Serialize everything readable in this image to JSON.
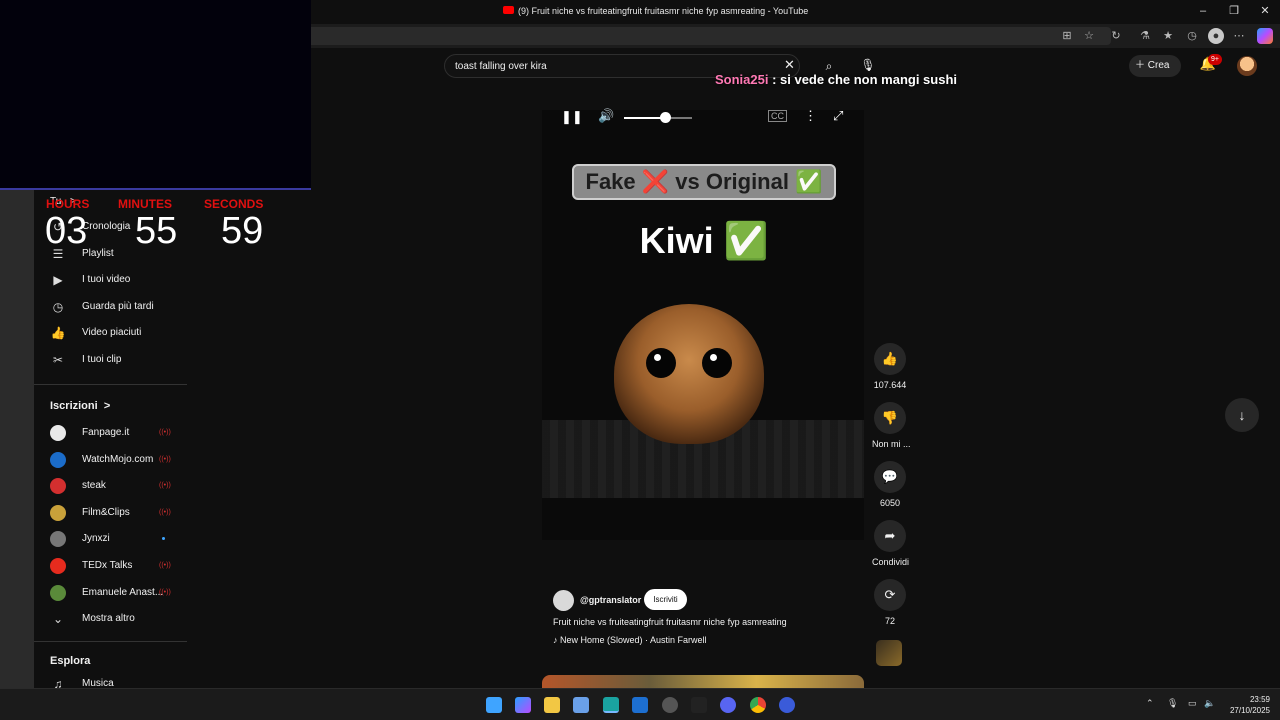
{
  "window": {
    "title": "(9) Fruit niche vs fruiteatingfruit fruitasmr niche fyp asmreating - YouTube",
    "controls": {
      "minimize": "–",
      "maximize": "❐",
      "close": "✕"
    }
  },
  "browser": {
    "icons": [
      "apps-icon",
      "favorite-icon",
      "refresh-icon",
      "extension-icon",
      "favorites-icon",
      "history-icon",
      "profile-icon",
      "more-icon",
      "copilot-icon"
    ]
  },
  "timer": {
    "labels": {
      "hours": "HOURS",
      "minutes": "MINUTES",
      "seconds": "SECONDS"
    },
    "values": {
      "hours": "03",
      "minutes": "55",
      "seconds": "59"
    }
  },
  "header": {
    "search_value": "toast falling over kira",
    "create_label": "Crea",
    "notifications_badge": "9+"
  },
  "chat_overlay": {
    "user": "Sonia25i",
    "message": " : si vede che non mangi sushi"
  },
  "sidebar": {
    "you_label": "Tu",
    "you_chevron": ">",
    "items": [
      {
        "label": "Cronologia",
        "icon": "history-icon",
        "glyph": "↺"
      },
      {
        "label": "Playlist",
        "icon": "playlist-icon",
        "glyph": "☰"
      },
      {
        "label": "I tuoi video",
        "icon": "your-videos-icon",
        "glyph": "▶"
      },
      {
        "label": "Guarda più tardi",
        "icon": "watch-later-icon",
        "glyph": "◷"
      },
      {
        "label": "Video piaciuti",
        "icon": "liked-videos-icon",
        "glyph": "👍"
      },
      {
        "label": "I tuoi clip",
        "icon": "clips-icon",
        "glyph": "✂"
      }
    ],
    "subscriptions_label": "Iscrizioni",
    "subscriptions_chevron": ">",
    "channels": [
      {
        "name": "Fanpage.it",
        "live": "((•))",
        "color": "#e9e9e9"
      },
      {
        "name": "WatchMojo.com",
        "live": "((•))",
        "color": "#1b6cc9"
      },
      {
        "name": "steak",
        "live": "((•))",
        "color": "#d32f2f"
      },
      {
        "name": "Film&Clips",
        "live": "((•))",
        "color": "#c9a13a"
      },
      {
        "name": "Jynxzi",
        "live": "",
        "color": "#777777"
      },
      {
        "name": "TEDx Talks",
        "live": "((•))",
        "color": "#e62b1e"
      },
      {
        "name": "Emanuele Anast...",
        "live": "((•))",
        "color": "#5a8a3a"
      }
    ],
    "show_more_label": "Mostra altro",
    "explore_label": "Esplora",
    "music_label": "Musica"
  },
  "player": {
    "volume": 0.6,
    "overlay_text": "Fake ❌ vs Original ✅",
    "title_text": "Kiwi ✅"
  },
  "channel": {
    "name": "@gptranslator",
    "subscribe_label": "Iscriviti",
    "description": "Fruit niche vs fruiteatingfruit fruitasmr niche fyp asmreating",
    "music": "♪ New Home (Slowed) · Austin Farwell"
  },
  "actions": {
    "likes": "107.644",
    "dislike_label": "Non mi ...",
    "comments": "6050",
    "share_label": "Condividi",
    "remix_count": "72"
  },
  "taskbar": {
    "time": "23:59",
    "date": "27/10/2025"
  }
}
